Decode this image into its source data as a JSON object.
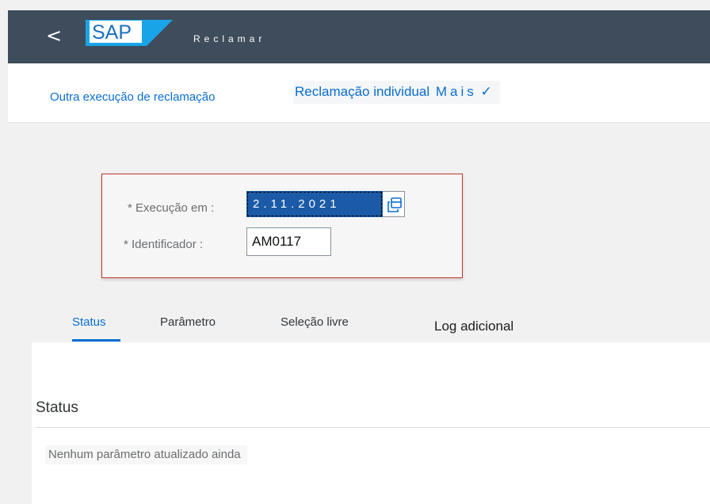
{
  "shell": {
    "back_label": "<",
    "logo_text": "SAP",
    "app_title": "Reclamar"
  },
  "toolbar": {
    "other_run_link": "Outra execução de reclamação",
    "individual_link": "Reclamação individual",
    "more_label": "Mais",
    "more_chevron": "✓"
  },
  "filter": {
    "date_label": "* Execução em :",
    "date_value": "2.11.2021",
    "id_label": "* Identificador :",
    "id_value": "AM0117"
  },
  "tabs": [
    {
      "label": "Status",
      "selected": true
    },
    {
      "label": "Parâmetro",
      "selected": false
    },
    {
      "label": "Seleção livre",
      "selected": false
    },
    {
      "label": "Log adicional",
      "selected": false
    }
  ],
  "status_section": {
    "title": "Status",
    "empty_message": "Nenhum parâmetro atualizado ainda"
  },
  "colors": {
    "shell_bg": "#3e4c5c",
    "link": "#0a6ed1",
    "sap_logo_blue": "#1aa4e8",
    "selection_bg": "#1a5aa6",
    "highlight_border": "#c0392b"
  },
  "icons": {
    "back": "chevron-left-icon",
    "value_help": "copy-calendar-icon"
  }
}
